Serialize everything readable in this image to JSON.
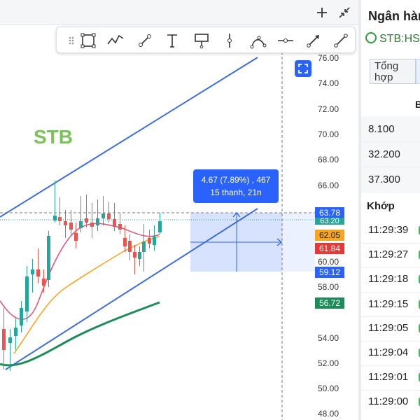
{
  "header": {
    "add_icon": "plus-icon",
    "collapse_icon": "collapse-arrows-icon"
  },
  "toolbar": {
    "tools": [
      {
        "name": "rectangle-tool-icon"
      },
      {
        "name": "polyline-tool-icon"
      },
      {
        "name": "trend-line-tool-icon"
      },
      {
        "name": "text-tool-icon"
      },
      {
        "name": "callout-tool-icon"
      },
      {
        "name": "vertical-line-tool-icon"
      },
      {
        "name": "arc-tool-icon"
      },
      {
        "name": "horizontal-ray-tool-icon"
      },
      {
        "name": "arrow-line-tool-icon"
      },
      {
        "name": "line-tool-icon"
      }
    ]
  },
  "chart": {
    "symbol_label": "STB",
    "measure": {
      "line1": "4.67 (7.89%) , 467",
      "line2": "15 thanh, 21n"
    },
    "price_ticks": [
      "76.00",
      "74.00",
      "72.00",
      "70.00",
      "68.00",
      "66.00",
      "60.00",
      "58.00",
      "54.00",
      "52.00",
      "50.00",
      "48.00"
    ],
    "price_tags": [
      {
        "label": "63.78",
        "color": "#2962ff"
      },
      {
        "label": "63.20",
        "color": "#26a69a"
      },
      {
        "label": "62.05",
        "color": "#f5a623"
      },
      {
        "label": "61.84",
        "color": "#e53935"
      },
      {
        "label": "59.12",
        "color": "#2962ff"
      },
      {
        "label": "56.72",
        "color": "#1e8c5a"
      }
    ],
    "colors": {
      "up": "#26a69a",
      "down": "#ef5350",
      "channel": "#3f6dd8",
      "ma_short": "#e0567a",
      "ma_mid": "#f5a623",
      "ma_long": "#1e8c5a",
      "measure_fill": "#c9d8ff"
    }
  },
  "side_panel": {
    "title": "Ngân hàn",
    "symbol": "STB:HS",
    "tab_summary": "Tổng hợp",
    "col_header": "B",
    "book_rows": [
      "8.100",
      "32.200",
      "37.300"
    ],
    "match_header": "Khớp",
    "match_rows": [
      "11:29:39",
      "11:29:27",
      "11:29:18",
      "11:29:15",
      "11:29:05",
      "11:29:04",
      "11:29:01",
      "11:29:00"
    ]
  }
}
